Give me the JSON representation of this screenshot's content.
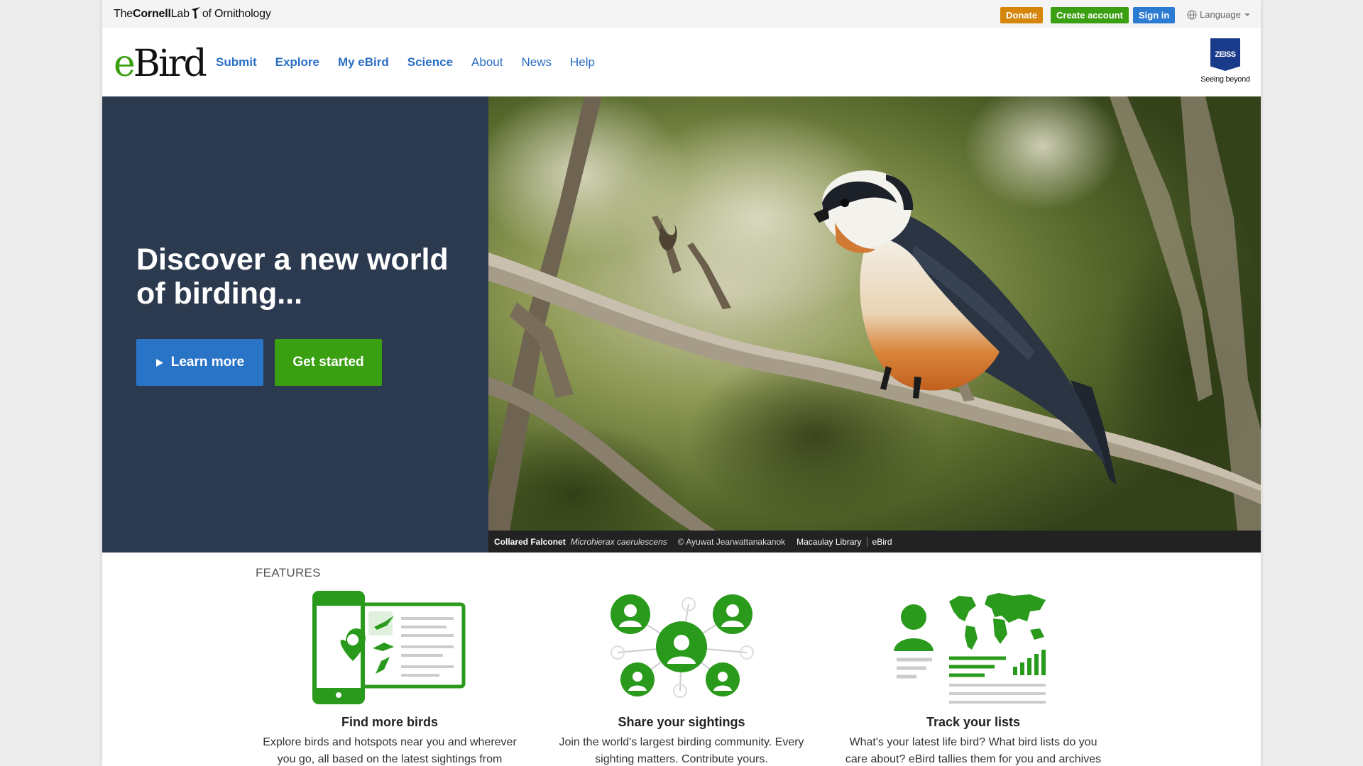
{
  "utility": {
    "lab_logo": {
      "the": "The",
      "cornell": "Cornell",
      "lab": "Lab",
      "of": "of Ornithology"
    },
    "donate": "Donate",
    "create_account": "Create account",
    "sign_in": "Sign in",
    "language": "Language"
  },
  "nav": {
    "logo_e": "e",
    "logo_rest": "Bird",
    "links": [
      {
        "label": "Submit"
      },
      {
        "label": "Explore"
      },
      {
        "label": "My eBird"
      },
      {
        "label": "Science"
      },
      {
        "label": "About"
      },
      {
        "label": "News"
      },
      {
        "label": "Help"
      }
    ],
    "sponsor_badge": "ZEISS",
    "sponsor_tagline": "Seeing beyond"
  },
  "hero": {
    "title": "Discover a new world of birding...",
    "learn_more": "Learn more",
    "get_started": "Get started",
    "caption": {
      "common_name": "Collared Falconet",
      "scientific_name": "Microhierax caerulescens",
      "credit": "© Ayuwat Jearwattanakanok",
      "library": "Macaulay Library",
      "source": "eBird"
    }
  },
  "features": {
    "label": "FEATURES",
    "items": [
      {
        "title": "Find more birds",
        "desc": "Explore birds and hotspots near you and wherever you go, all based on the latest sightings from around"
      },
      {
        "title": "Share your sightings",
        "desc": "Join the world's largest birding community. Every sighting matters. Contribute yours."
      },
      {
        "title": "Track your lists",
        "desc": "What's your latest life bird? What bird lists do you care about? eBird tallies them for you and archives"
      }
    ]
  },
  "colors": {
    "brand_green": "#3aa012",
    "brand_blue": "#2a74c8",
    "donate_orange": "#d6860a",
    "hero_panel": "#2c3a4f"
  }
}
